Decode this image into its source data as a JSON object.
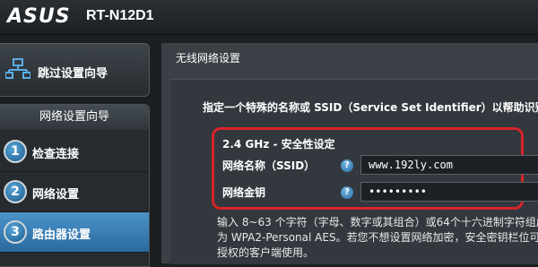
{
  "header": {
    "logo": "ASUS",
    "model": "RT-N12D1"
  },
  "sidebar": {
    "skip_label": "跳过设置向导",
    "wizard_title": "网络设置向导",
    "steps": [
      {
        "num": "1",
        "label": "检查连接"
      },
      {
        "num": "2",
        "label": "网络设置"
      },
      {
        "num": "3",
        "label": "路由器设置"
      }
    ]
  },
  "main": {
    "title": "无线网络设置",
    "description": "指定一个特殊的名称或 SSID（Service Set Identifier）以帮助识别您",
    "section_title": "2.4 GHz - 安全性设定",
    "ssid_label": "网络名称（SSID）",
    "ssid_value": "www.192ly.com",
    "key_label": "网络金钥",
    "key_value": "•••••••••",
    "help_glyph": "?",
    "note_lines": [
      "输入 8~63 个字符（字母、数字或其组合）或64个十六进制字符组成",
      "为 WPA2-Personal AES。若您不想设置网络加密，安全密钥栏位可保",
      "授权的客户端使用。"
    ]
  },
  "colors": {
    "highlight": "#d8232a",
    "active_step": "#3a7fb6"
  }
}
